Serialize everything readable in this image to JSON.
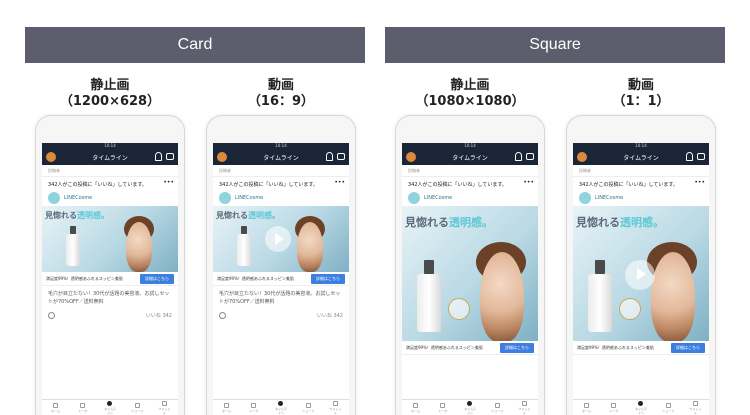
{
  "headers": {
    "card": "Card",
    "square": "Square"
  },
  "columns": [
    {
      "title": "静止画",
      "spec": "（1200×628）"
    },
    {
      "title": "動画",
      "spec": "（16：9）"
    },
    {
      "title": "静止画",
      "spec": "（1080×1080）"
    },
    {
      "title": "動画",
      "spec": "（1：1）"
    }
  ],
  "phone": {
    "status_time": "10:14",
    "nav_title": "タイムライン",
    "sub_text": "投稿者",
    "likes_text": "342人がこの投稿に「いいね」しています。",
    "more": "•••",
    "brand_name": "LINECosme",
    "headline_prefix": "見惚れる",
    "headline_highlight": "透明感。",
    "cta_text": "満足度99%！透明感あふれるスッピン美肌",
    "cta_button": "詳細はこちら",
    "body_text": "毛穴が目立たない！30代が話題の美容液。お試しセットが70%OFF／送料無料",
    "like_count": "いいね 342",
    "tabs": [
      "ホーム",
      "トーク",
      "タイムライン",
      "ニュース",
      "ウォレット"
    ]
  }
}
